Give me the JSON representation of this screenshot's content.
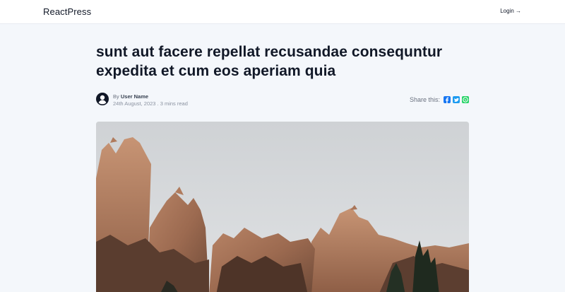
{
  "header": {
    "brand": "ReactPress",
    "login_label": "Login →"
  },
  "post": {
    "title": "sunt aut facere repellat recusandae consequntur expedita et cum eos aperiam quia",
    "by_prefix": "By",
    "author": "User Name",
    "date_line": "24th August, 2023 . 3 mins read"
  },
  "share": {
    "label": "Share this:",
    "networks": [
      "facebook",
      "twitter",
      "whatsapp"
    ]
  },
  "hero_image": {
    "subject": "red rock cliffs against a pale grey sky with pine trees"
  },
  "colors": {
    "facebook": "#1877f2",
    "twitter": "#1d9bf0",
    "whatsapp": "#25d366"
  }
}
